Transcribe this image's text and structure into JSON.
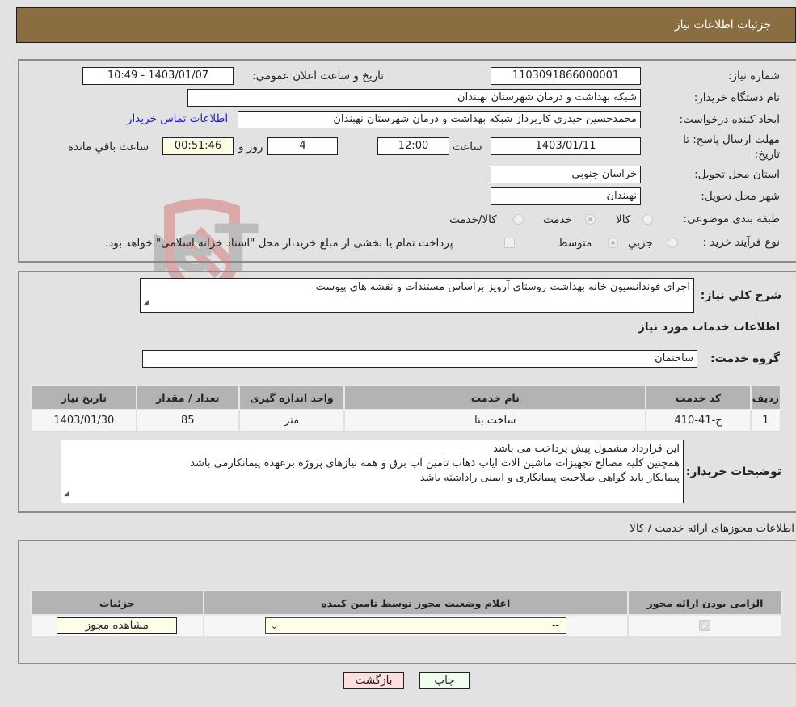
{
  "header": {
    "title": "جزئیات اطلاعات نیاز"
  },
  "details": {
    "need_number_label": "شماره نیاز:",
    "need_number": "1103091866000001",
    "announce_label": "تاريخ و ساعت اعلان عمومي:",
    "announce_value": "1403/01/07 - 10:49",
    "buyer_org_label": "نام دستگاه خريدار:",
    "buyer_org": "شبکه بهداشت و درمان شهرستان نهبندان",
    "requester_label": "ايجاد کننده درخواست:",
    "requester": "محمدحسین حیدری کاربرداز شبکه بهداشت و درمان شهرستان نهبندان",
    "buyer_contact_link": "اطلاعات تماس خريدار",
    "deadline_label_line1": "مهلت ارسال پاسخ: تا",
    "deadline_label_line2": "تاريخ:",
    "deadline_date": "1403/01/11",
    "time_label": "ساعت",
    "deadline_time": "12:00",
    "days_value": "4",
    "days_label": "روز و",
    "remaining_time": "00:51:46",
    "remaining_label": "ساعت باقي مانده",
    "province_label": "استان محل تحويل:",
    "province": "خراسان جنوبی",
    "city_label": "شهر محل تحويل:",
    "city": "نهبندان",
    "category_label": "طبقه بندی موضوعی:",
    "category_options": [
      {
        "label": "کالا",
        "checked": false
      },
      {
        "label": "خدمت",
        "checked": true
      },
      {
        "label": "کالا/خدمت",
        "checked": false
      }
    ],
    "process_label": "نوع فرآیند خريد :",
    "process_options": [
      {
        "label": "جزيي",
        "checked": false
      },
      {
        "label": "متوسط",
        "checked": true
      }
    ],
    "treasury_note": "پرداخت تمام يا بخشی از مبلغ خريد،از محل \"اسناد خزانه اسلامی\" خواهد بود.",
    "treasury_checked": false
  },
  "summary": {
    "description_label": "شرح کلي نياز:",
    "description": "اجرای فوندانسیون خانه بهداشت روستای آرویز براساس مستندات و نقشه های پیوست",
    "services_heading": "اطلاعات خدمات مورد نياز",
    "service_group_label": "گروه خدمت:",
    "service_group": "ساختمان",
    "table": {
      "headers": [
        "رديف",
        "کد خدمت",
        "نام خدمت",
        "واحد اندازه گيری",
        "تعداد / مقدار",
        "تاريخ نياز"
      ],
      "rows": [
        [
          "1",
          "ج-41-410",
          "ساخت بنا",
          "متر",
          "85",
          "1403/01/30"
        ]
      ]
    },
    "buyer_notes_label": "توضيحات خريدار:",
    "buyer_notes": [
      "این قرارداد مشمول پیش پرداخت می باشد",
      "همچنین کلیه مصالح تجهیزات ماشین آلات ایاب ذهاب تامین آب برق و همه نیازهای پروژه برعهده پیمانکارمی باشد",
      "پیمانکار باید گواهی صلاحیت پیمانکاری و ایمنی راداشته باشد"
    ]
  },
  "licenses": {
    "heading": "اطلاعات مجوزهای ارائه خدمت / کالا",
    "headers": [
      "الزامی بودن ارائه مجوز",
      "اعلام وضعیت مجوز توسط تامین کننده",
      "جزئيات"
    ],
    "row": {
      "required_checked": true,
      "status_selected": "--",
      "view_button": "مشاهده مجوز"
    }
  },
  "footer": {
    "print_button": "چاپ",
    "back_button": "بازگشت"
  },
  "watermark": {
    "text": "AriaTender.neT"
  },
  "colors": {
    "header_bg": "#8b6d42",
    "back_button_bg": "#ffdede",
    "print_button_bg": "#eeffee",
    "link": "#2222cc"
  }
}
